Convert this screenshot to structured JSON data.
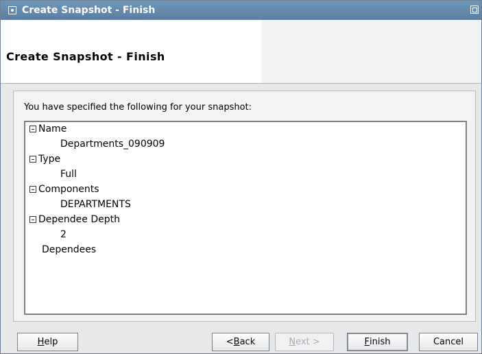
{
  "window": {
    "title": "Create Snapshot - Finish"
  },
  "header": {
    "title": "Create Snapshot - Finish"
  },
  "content": {
    "intro": "You have specified the following for your snapshot:",
    "tree": [
      {
        "label": "Name",
        "value": "Departments_090909"
      },
      {
        "label": "Type",
        "value": "Full"
      },
      {
        "label": "Components",
        "value": "DEPARTMENTS"
      },
      {
        "label": "Dependee Depth",
        "value": "2"
      },
      {
        "label": "Dependees"
      }
    ]
  },
  "buttons": {
    "help": {
      "mnemonic": "H",
      "rest": "elp"
    },
    "back": {
      "prefix": "< ",
      "mnemonic": "B",
      "rest": "ack"
    },
    "next": {
      "mnemonic": "N",
      "rest": "ext >"
    },
    "finish": {
      "mnemonic": "F",
      "rest": "inish"
    },
    "cancel": {
      "label": "Cancel"
    }
  },
  "colors": {
    "titlebar": "#5f84a8",
    "dialog_bg": "#e7e8ea",
    "panel_bg": "#f3f3f3"
  },
  "icons": {
    "window_menu": "window-menu-icon",
    "window_restore": "restore-icon",
    "tree_toggle": "collapse-node-icon"
  }
}
